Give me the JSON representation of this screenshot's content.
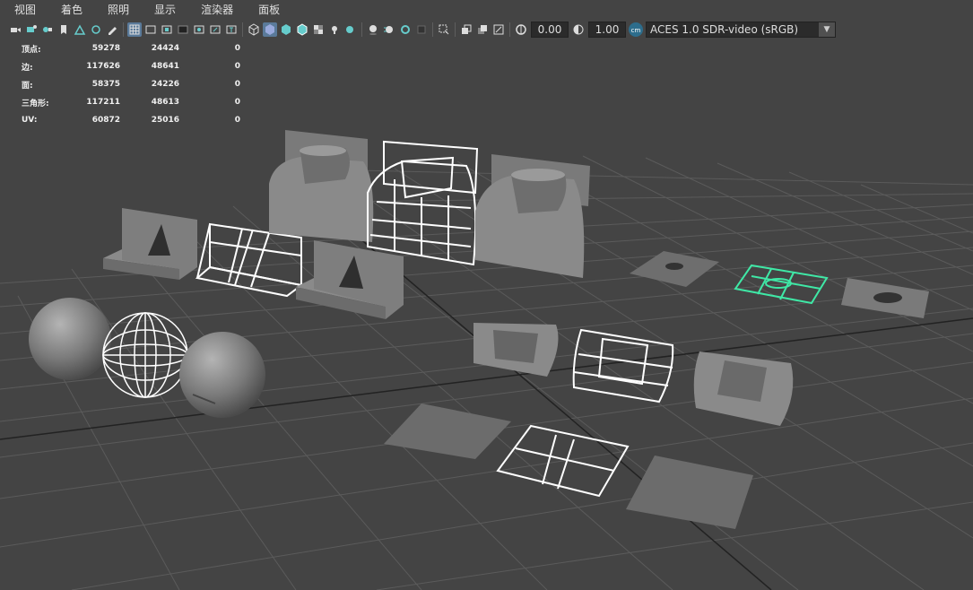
{
  "menu": [
    {
      "id": "view",
      "label": "视图"
    },
    {
      "id": "shading",
      "label": "着色"
    },
    {
      "id": "lighting",
      "label": "照明"
    },
    {
      "id": "show",
      "label": "显示"
    },
    {
      "id": "renderer",
      "label": "渲染器"
    },
    {
      "id": "panels",
      "label": "面板"
    }
  ],
  "toolbar": {
    "exposure_value": "0.00",
    "gamma_value": "1.00",
    "colorspace_label": "ACES 1.0 SDR-video (sRGB)"
  },
  "hud": {
    "rows": [
      {
        "label": "顶点:",
        "c1": "59278",
        "c2": "24424",
        "c3": "0"
      },
      {
        "label": "边:",
        "c1": "117626",
        "c2": "48641",
        "c3": "0"
      },
      {
        "label": "面:",
        "c1": "58375",
        "c2": "24226",
        "c3": "0"
      },
      {
        "label": "三角形:",
        "c1": "117211",
        "c2": "48613",
        "c3": "0"
      },
      {
        "label": "UV:",
        "c1": "60872",
        "c2": "25016",
        "c3": "0"
      }
    ]
  },
  "colors": {
    "background": "#444444",
    "grid": "#5c5c5c",
    "mesh_gray": "#7c7c7c",
    "wire": "#ffffff",
    "selected": "#3fe8a6",
    "accent_active": "#5a7a9a"
  }
}
